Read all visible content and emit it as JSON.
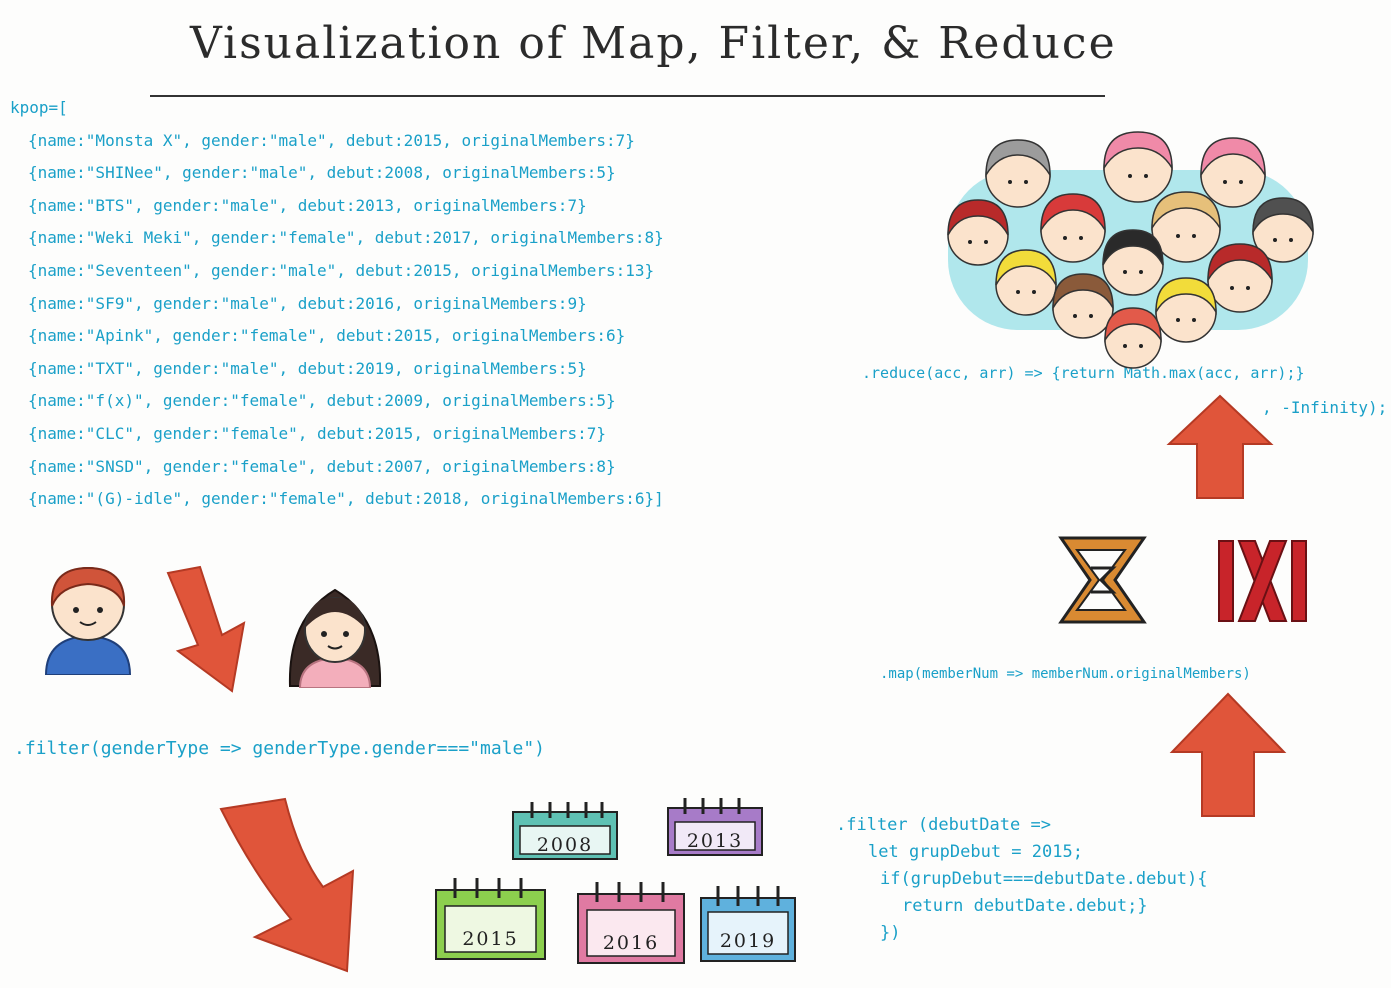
{
  "title": "Visualization of Map, Filter, & Reduce",
  "kpop": {
    "opening": "kpop=[",
    "items": [
      "{name:\"Monsta X\", gender:\"male\", debut:2015, originalMembers:7}",
      "{name:\"SHINee\", gender:\"male\", debut:2008, originalMembers:5}",
      "{name:\"BTS\", gender:\"male\", debut:2013, originalMembers:7}",
      "{name:\"Weki Meki\", gender:\"female\", debut:2017, originalMembers:8}",
      "{name:\"Seventeen\", gender:\"male\", debut:2015, originalMembers:13}",
      "{name:\"SF9\", gender:\"male\", debut:2016, originalMembers:9}",
      "{name:\"Apink\", gender:\"female\", debut:2015, originalMembers:6}",
      "{name:\"TXT\", gender:\"male\", debut:2019, originalMembers:5}",
      "{name:\"f(x)\", gender:\"female\", debut:2009, originalMembers:5}",
      "{name:\"CLC\", gender:\"female\", debut:2015, originalMembers:7}",
      "{name:\"SNSD\", gender:\"female\", debut:2007, originalMembers:8}",
      "{name:\"(G)-idle\", gender:\"female\", debut:2018, originalMembers:6}]"
    ]
  },
  "filter_gender": ".filter(genderType => genderType.gender===\"male\")",
  "filter_debut": {
    "lines": [
      ".filter (debutDate =>",
      "let grupDebut = 2015;",
      "if(grupDebut===debutDate.debut){",
      "return debutDate.debut;}",
      "})"
    ]
  },
  "map_call": ".map(memberNum => memberNum.originalMembers)",
  "reduce_call": {
    "line1": ".reduce(acc, arr) => {return Math.max(acc, arr);}",
    "line2": ", -Infinity);"
  },
  "calendars": [
    {
      "year": "2008",
      "color": "#5fc1b4"
    },
    {
      "year": "2013",
      "color": "#a77bc8"
    },
    {
      "year": "2015",
      "color": "#8ccf4e"
    },
    {
      "year": "2016",
      "color": "#e07aa2"
    },
    {
      "year": "2019",
      "color": "#5fb1dd"
    }
  ],
  "colors": {
    "code_text": "#1aa0c8",
    "arrow_red": "#e0553a",
    "arrow_light": "#f3a08c",
    "mx_red": "#c8242a",
    "seventeen_orange": "#d98a32",
    "boy_shirt": "#3a6fc4",
    "girl_shirt": "#f3aebb"
  },
  "icons": {
    "boy": "boy-avatar-icon",
    "girl": "girl-avatar-icon",
    "crowd": "kpop-crowd-icon",
    "seventeen": "seventeen-logo-icon",
    "monstax": "monsta-x-logo-icon"
  }
}
